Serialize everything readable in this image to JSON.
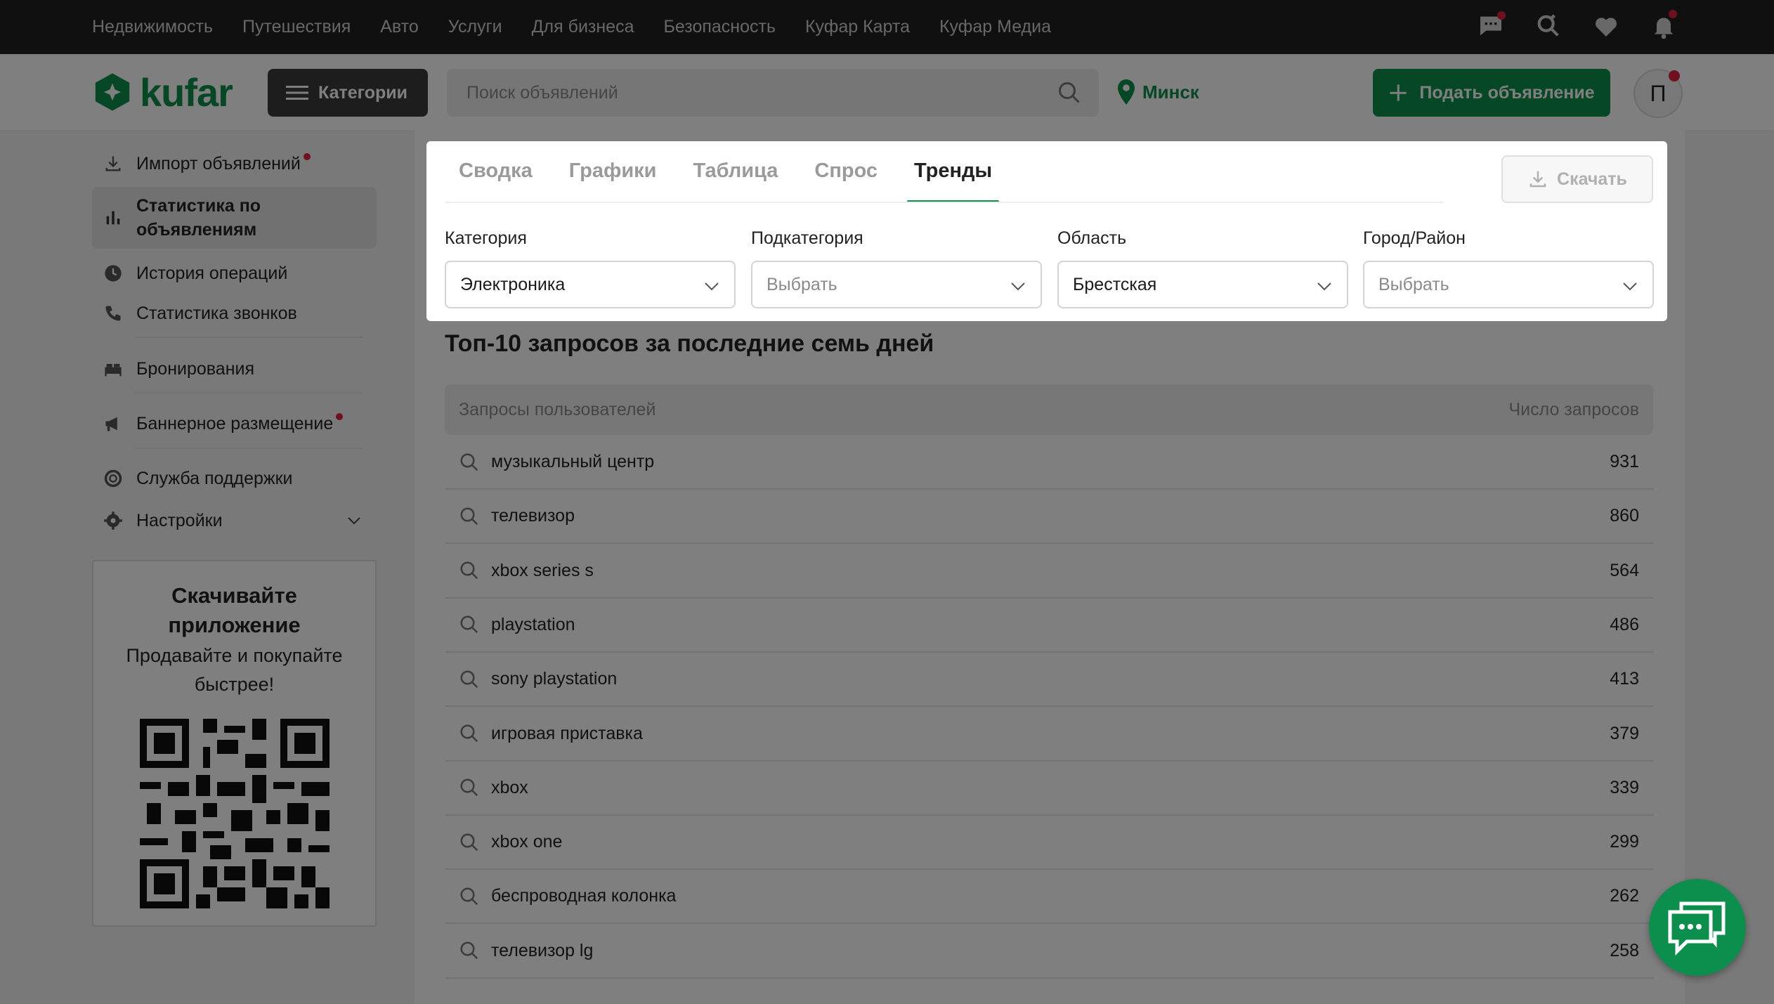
{
  "topnav": {
    "links": [
      "Недвижимость",
      "Путешествия",
      "Авто",
      "Услуги",
      "Для бизнеса",
      "Безопасность",
      "Куфар Карта",
      "Куфар Медиа"
    ],
    "icons": [
      "chat-icon",
      "saved-search-icon",
      "heart-icon",
      "bell-icon"
    ]
  },
  "header": {
    "logo_text": "kufar",
    "categories_label": "Категории",
    "search_placeholder": "Поиск объявлений",
    "city": "Минск",
    "post_label": "Подать объявление",
    "avatar_letter": "П"
  },
  "sidebar": {
    "items": [
      {
        "label": "Импорт объявлений",
        "icon": "download-icon",
        "dot": true
      },
      {
        "label": "Статистика по объявлениям",
        "icon": "bar-chart-icon",
        "active": true
      },
      {
        "label": "История операций",
        "icon": "clock-icon"
      },
      {
        "label": "Статистика звонков",
        "icon": "phone-icon"
      },
      {
        "label": "Бронирования",
        "icon": "bed-icon"
      },
      {
        "label": "Баннерное размещение",
        "icon": "megaphone-icon",
        "dot": true
      },
      {
        "label": "Служба поддержки",
        "icon": "lifebuoy-icon"
      },
      {
        "label": "Настройки",
        "icon": "gear-icon"
      }
    ],
    "app_title": "Скачивайте приложение",
    "app_subtitle": "Продавайте и покупайте быстрее!"
  },
  "tabs": {
    "items": [
      "Сводка",
      "Графики",
      "Таблица",
      "Спрос",
      "Тренды"
    ],
    "active": "Тренды",
    "download_label": "Скачать"
  },
  "filters": [
    {
      "label": "Категория",
      "value": "Электроника",
      "placeholder": false
    },
    {
      "label": "Подкатегория",
      "value": "Выбрать",
      "placeholder": true
    },
    {
      "label": "Область",
      "value": "Брестская",
      "placeholder": false
    },
    {
      "label": "Город/Район",
      "value": "Выбрать",
      "placeholder": true
    }
  ],
  "top_requests": {
    "title": "Топ-10 запросов за последние семь дней",
    "col_query": "Запросы пользователей",
    "col_count": "Число запросов",
    "rows": [
      {
        "query": "музыкальный центр",
        "count": "931"
      },
      {
        "query": "телевизор",
        "count": "860"
      },
      {
        "query": "xbox series s",
        "count": "564"
      },
      {
        "query": "playstation",
        "count": "486"
      },
      {
        "query": "sony playstation",
        "count": "413"
      },
      {
        "query": "игровая приставка",
        "count": "379"
      },
      {
        "query": "xbox",
        "count": "339"
      },
      {
        "query": "xbox one",
        "count": "299"
      },
      {
        "query": "беспроводная колонка",
        "count": "262"
      },
      {
        "query": "телевизор lg",
        "count": "258"
      }
    ]
  },
  "colors": {
    "brand_green": "#0c8f4d",
    "nav_dark": "#212121",
    "badge_red": "#e0203c"
  }
}
